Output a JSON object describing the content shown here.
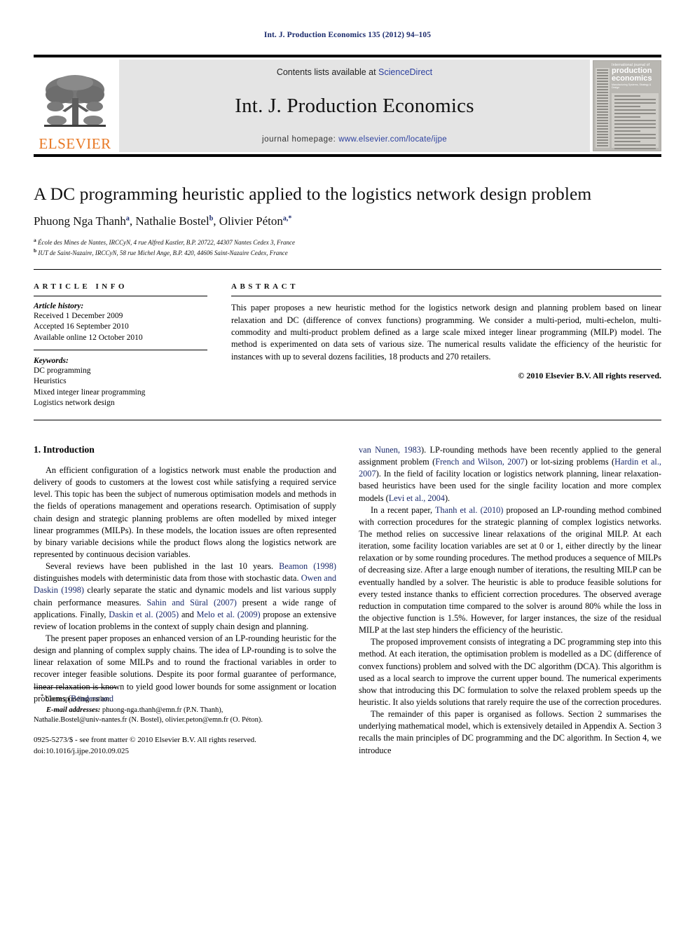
{
  "running_head": "Int. J. Production Economics 135 (2012) 94–105",
  "masthead": {
    "contents_prefix": "Contents lists available at ",
    "sciencedirect": "ScienceDirect",
    "journal_title": "Int. J. Production Economics",
    "homepage_prefix": "journal homepage: ",
    "homepage_url": "www.elsevier.com/locate/ijpe",
    "publisher_wordmark": "ELSEVIER",
    "link_color": "#2b3f9e",
    "elsevier_orange": "#E87722"
  },
  "cover": {
    "line_top": "International  journal of",
    "line_main_1": "production",
    "line_main_2": "economics",
    "line_sub": "Manufacturing Systems, Strategy & Design"
  },
  "article": {
    "title": "A DC programming heuristic applied to the logistics network design problem",
    "authors": [
      {
        "name": "Phuong Nga Thanh",
        "marks": "a"
      },
      {
        "name": "Nathalie Bostel",
        "marks": "b"
      },
      {
        "name": "Olivier Péton",
        "marks": "a,*"
      }
    ],
    "affiliations": [
      {
        "mark": "a",
        "text": "École des Mines de Nantes, IRCCyN, 4 rue Alfred Kastler, B.P. 20722, 44307 Nantes Cedex 3, France"
      },
      {
        "mark": "b",
        "text": "IUT de Saint-Nazaire, IRCCyN, 58 rue Michel Ange, B.P. 420, 44606 Saint-Nazaire Cedex, France"
      }
    ]
  },
  "article_info": {
    "heading": "ARTICLE INFO",
    "history_label": "Article history:",
    "history": [
      "Received 1 December 2009",
      "Accepted 16 September 2010",
      "Available online 12 October 2010"
    ],
    "keywords_label": "Keywords:",
    "keywords": [
      "DC programming",
      "Heuristics",
      "Mixed integer linear programming",
      "Logistics network design"
    ]
  },
  "abstract": {
    "heading": "ABSTRACT",
    "text": "This paper proposes a new heuristic method for the logistics network design and planning problem based on linear relaxation and DC (difference of convex functions) programming. We consider a multi-period, multi-echelon, multi-commodity and multi-product problem defined as a large scale mixed integer linear programming (MILP) model. The method is experimented on data sets of various size. The numerical results validate the efficiency of the heuristic for instances with up to several dozens facilities, 18 products and 270 retailers.",
    "copyright": "© 2010 Elsevier B.V. All rights reserved."
  },
  "introduction": {
    "section_number_title": "1. Introduction",
    "left_paragraphs": [
      {
        "segments": [
          {
            "text": "An efficient configuration of a logistics network must enable the production and delivery of goods to customers at the lowest cost while satisfying a required service level. This topic has been the subject of numerous optimisation models and methods in the fields of operations management and operations research. Optimisation of supply chain design and strategic planning problems are often modelled by mixed integer linear programmes (MILPs). In these models, the location issues are often represented by binary variable decisions while the product flows along the logistics network are represented by continuous decision variables.",
            "cite": false
          }
        ]
      },
      {
        "segments": [
          {
            "text": "Several reviews have been published in the last 10 years. ",
            "cite": false
          },
          {
            "text": "Beamon (1998)",
            "cite": true
          },
          {
            "text": " distinguishes models with deterministic data from those with stochastic data. ",
            "cite": false
          },
          {
            "text": "Owen and Daskin (1998)",
            "cite": true
          },
          {
            "text": " clearly separate the static and dynamic models and list various supply chain performance measures. ",
            "cite": false
          },
          {
            "text": "Sahin and Süral (2007)",
            "cite": true
          },
          {
            "text": " present a wide range of applications. Finally, ",
            "cite": false
          },
          {
            "text": "Daskin et al. (2005)",
            "cite": true
          },
          {
            "text": " and ",
            "cite": false
          },
          {
            "text": "Melo et al. (2009)",
            "cite": true
          },
          {
            "text": " propose an extensive review of location problems in the context of supply chain design and planning.",
            "cite": false
          }
        ]
      },
      {
        "segments": [
          {
            "text": "The present paper proposes an enhanced version of an LP-rounding heuristic for the design and planning of complex supply chains. The idea of LP-rounding is to solve the linear relaxation of some MILPs and to round the fractional variables in order to recover integer feasible solutions. Despite its poor formal guarantee of performance, linear relaxation is known to yield good lower bounds for some assignment or location problems (",
            "cite": false
          },
          {
            "text": "Benders and",
            "cite": true
          }
        ]
      }
    ],
    "right_paragraphs": [
      {
        "segments": [
          {
            "text": "van Nunen, 1983",
            "cite": true
          },
          {
            "text": "). LP-rounding methods have been recently applied to the general assignment problem (",
            "cite": false
          },
          {
            "text": "French and Wilson, 2007",
            "cite": true
          },
          {
            "text": ") or lot-sizing problems (",
            "cite": false
          },
          {
            "text": "Hardin et al., 2007",
            "cite": true
          },
          {
            "text": "). In the field of facility location or logistics network planning, linear relaxation-based heuristics have been used for the single facility location and more complex models (",
            "cite": false
          },
          {
            "text": "Levi et al., 2004",
            "cite": true
          },
          {
            "text": ").",
            "cite": false
          }
        ]
      },
      {
        "segments": [
          {
            "text": "In a recent paper, ",
            "cite": false
          },
          {
            "text": "Thanh et al. (2010)",
            "cite": true
          },
          {
            "text": " proposed an LP-rounding method combined with correction procedures for the strategic planning of complex logistics networks. The method relies on successive linear relaxations of the original MILP. At each iteration, some facility location variables are set at 0 or 1, either directly by the linear relaxation or by some rounding procedures. The method produces a sequence of MILPs of decreasing size. After a large enough number of iterations, the resulting MILP can be eventually handled by a solver. The heuristic is able to produce feasible solutions for every tested instance thanks to efficient correction procedures. The observed average reduction in computation time compared to the solver is around 80% while the loss in the objective function is 1.5%. However, for larger instances, the size of the residual MILP at the last step hinders the efficiency of the heuristic.",
            "cite": false
          }
        ]
      },
      {
        "segments": [
          {
            "text": "The proposed improvement consists of integrating a DC programming step into this method. At each iteration, the optimisation problem is modelled as a DC (difference of convex functions) problem and solved with the DC algorithm (DCA). This algorithm is used as a local search to improve the current upper bound. The numerical experiments show that introducing this DC formulation to solve the relaxed problem speeds up the heuristic. It also yields solutions that rarely require the use of the correction procedures.",
            "cite": false
          }
        ]
      },
      {
        "segments": [
          {
            "text": "The remainder of this paper is organised as follows. Section 2 summarises the underlying mathematical model, which is extensively detailed in Appendix A. Section 3 recalls the main principles of DC programming and the DC algorithm. In Section 4, we introduce",
            "cite": false
          }
        ]
      }
    ]
  },
  "footnote": {
    "corresponding_mark": "*",
    "corresponding_text": "Corresponding author.",
    "email_label": "E-mail addresses:",
    "email_line_1": " phuong-nga.thanh@emn.fr (P.N. Thanh),",
    "email_line_2": "Nathalie.Bostel@univ-nantes.fr (N. Bostel), olivier.peton@emn.fr (O. Péton)."
  },
  "imprint": {
    "issn_line": "0925-5273/$ - see front matter © 2010 Elsevier B.V. All rights reserved.",
    "doi_line": "doi:10.1016/j.ijpe.2010.09.025"
  }
}
